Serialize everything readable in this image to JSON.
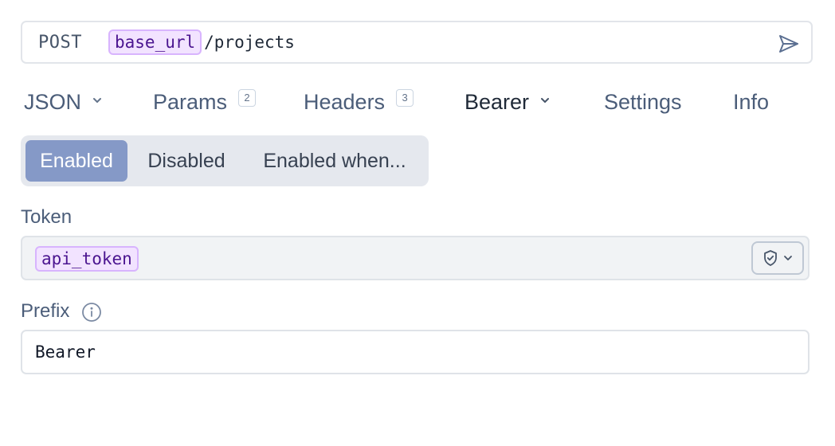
{
  "request": {
    "method": "POST",
    "url_variable": "base_url",
    "url_path": "/projects"
  },
  "tabs": [
    {
      "label": "JSON",
      "has_dropdown": true
    },
    {
      "label": "Params",
      "count": "2"
    },
    {
      "label": "Headers",
      "count": "3"
    },
    {
      "label": "Bearer",
      "has_dropdown": true,
      "active": true
    },
    {
      "label": "Settings"
    },
    {
      "label": "Info"
    }
  ],
  "auth_state": {
    "options": [
      "Enabled",
      "Disabled",
      "Enabled when..."
    ],
    "selected": "Enabled"
  },
  "token": {
    "label": "Token",
    "value_variable": "api_token"
  },
  "prefix": {
    "label": "Prefix",
    "value": "Bearer"
  },
  "icons": {
    "send": "send-icon",
    "chevron": "chevron-down-icon",
    "shield": "shield-check-icon",
    "info": "info-icon"
  },
  "colors": {
    "active_segment": "#8599c7",
    "variable_chip_bg": "#f2e3ff",
    "variable_chip_border": "#d8b4fe",
    "variable_chip_text": "#4b1590"
  }
}
